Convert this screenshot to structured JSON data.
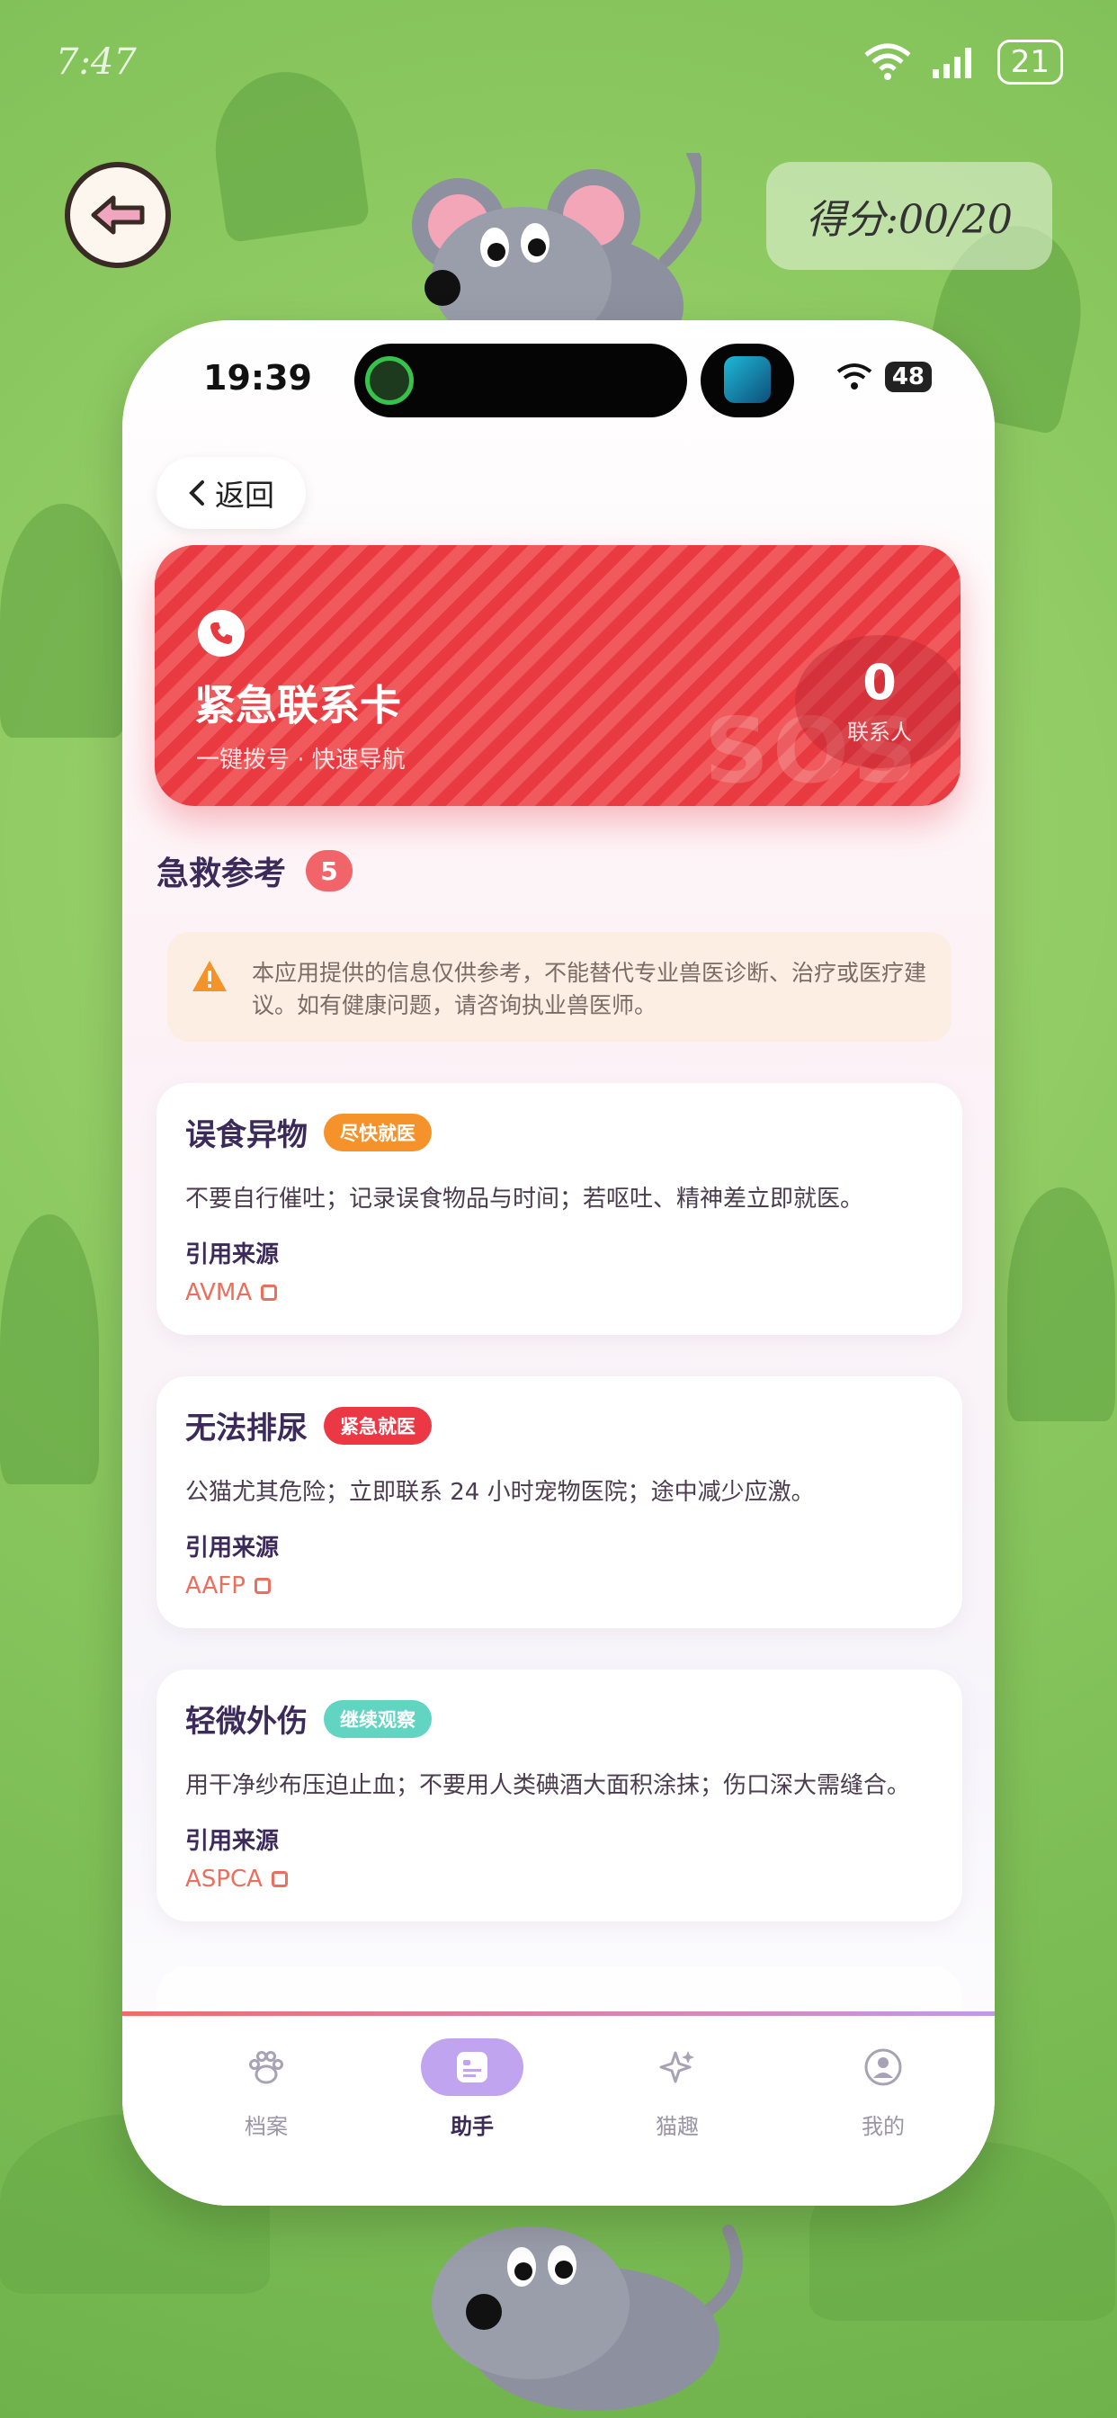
{
  "outer_status": {
    "time": "7:47",
    "battery": "21"
  },
  "score": "得分:00/20",
  "phone_status": {
    "time": "19:39",
    "battery": "48"
  },
  "back_label": "返回",
  "sos_card": {
    "title": "紧急联系卡",
    "subtitle": "一键拨号 · 快速导航",
    "watermark": "SOS",
    "contact_count": "0",
    "contact_label": "联系人"
  },
  "section": {
    "title": "急救参考",
    "count": "5"
  },
  "disclaimer": "本应用提供的信息仅供参考，不能替代专业兽医诊断、治疗或医疗建议。如有健康问题，请咨询执业兽医师。",
  "cards": [
    {
      "title": "误食异物",
      "tag": "尽快就医",
      "desc": "不要自行催吐；记录误食物品与时间；若呕吐、精神差立即就医。",
      "source_label": "引用来源",
      "source": "AVMA"
    },
    {
      "title": "无法排尿",
      "tag": "紧急就医",
      "desc": "公猫尤其危险；立即联系 24 小时宠物医院；途中减少应激。",
      "source_label": "引用来源",
      "source": "AAFP"
    },
    {
      "title": "轻微外伤",
      "tag": "继续观察",
      "desc": "用干净纱布压迫止血；不要用人类碘酒大面积涂抹；伤口深大需缝合。",
      "source_label": "引用来源",
      "source": "ASPCA"
    }
  ],
  "tabs": [
    {
      "label": "档案",
      "icon": "paw-icon"
    },
    {
      "label": "助手",
      "icon": "assistant-icon"
    },
    {
      "label": "猫趣",
      "icon": "sparkle-icon"
    },
    {
      "label": "我的",
      "icon": "user-icon"
    }
  ],
  "colors": {
    "sos_red": "#e83a40",
    "accent_purple": "#c1a4ef",
    "tag_orange": "#f5922a",
    "tag_red": "#ec3844",
    "tag_teal": "#62d4c2"
  }
}
